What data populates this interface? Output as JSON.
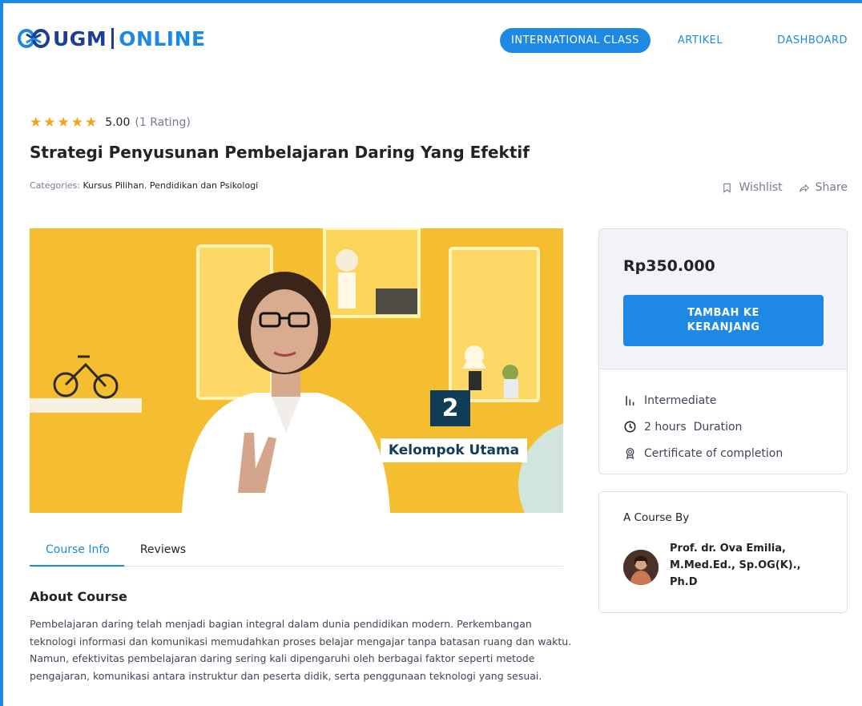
{
  "header": {
    "logo_ugm": "UGM",
    "logo_online": "ONLINE",
    "nav": {
      "international": "INTERNATIONAL CLASS",
      "artikel": "ARTIKEL",
      "dashboard": "DASHBOARD"
    }
  },
  "course": {
    "stars": "★★★★★",
    "rating_value": "5.00",
    "rating_count": "(1 Rating)",
    "title": "Strategi Penyusunan Pembelajaran Daring Yang Efektif",
    "categories_label": "Categories:",
    "categories": [
      "Kursus Pilihan",
      "Pendidikan dan Psikologi"
    ],
    "category_separator": ",",
    "wishlist_label": "Wishlist",
    "share_label": "Share"
  },
  "video": {
    "badge_number": "2",
    "caption": "Kelompok Utama"
  },
  "tabs": {
    "course_info": "Course Info",
    "reviews": "Reviews"
  },
  "about": {
    "heading": "About Course",
    "text": "Pembelajaran daring telah menjadi bagian integral dalam dunia pendidikan modern. Perkembangan teknologi informasi dan komunikasi memudahkan proses belajar mengajar tanpa batasan ruang dan waktu. Namun, efektivitas pembelajaran daring sering kali dipengaruhi oleh berbagai faktor seperti metode pengajaran, komunikasi antara instruktur dan peserta didik, serta penggunaan teknologi yang sesuai."
  },
  "sidebar": {
    "price": "Rp350.000",
    "cart_button": "TAMBAH KE KERANJANG",
    "level": "Intermediate",
    "duration": "2 hours  Duration",
    "certificate": "Certificate of completion",
    "author_label": "A Course By",
    "author_name": "Prof. dr. Ova Emilia, M.Med.Ed., Sp.OG(K)., Ph.D"
  },
  "icons": {
    "wishlist": "bookmark-icon",
    "share": "share-arrow-icon",
    "level": "level-bars-icon",
    "duration": "clock-icon",
    "certificate": "certificate-icon",
    "star": "star-icon"
  },
  "colors": {
    "accent": "#1e88e5",
    "brand_dark": "#1b3f94",
    "star": "#f3a41b",
    "video_bg": "#f4b928"
  }
}
